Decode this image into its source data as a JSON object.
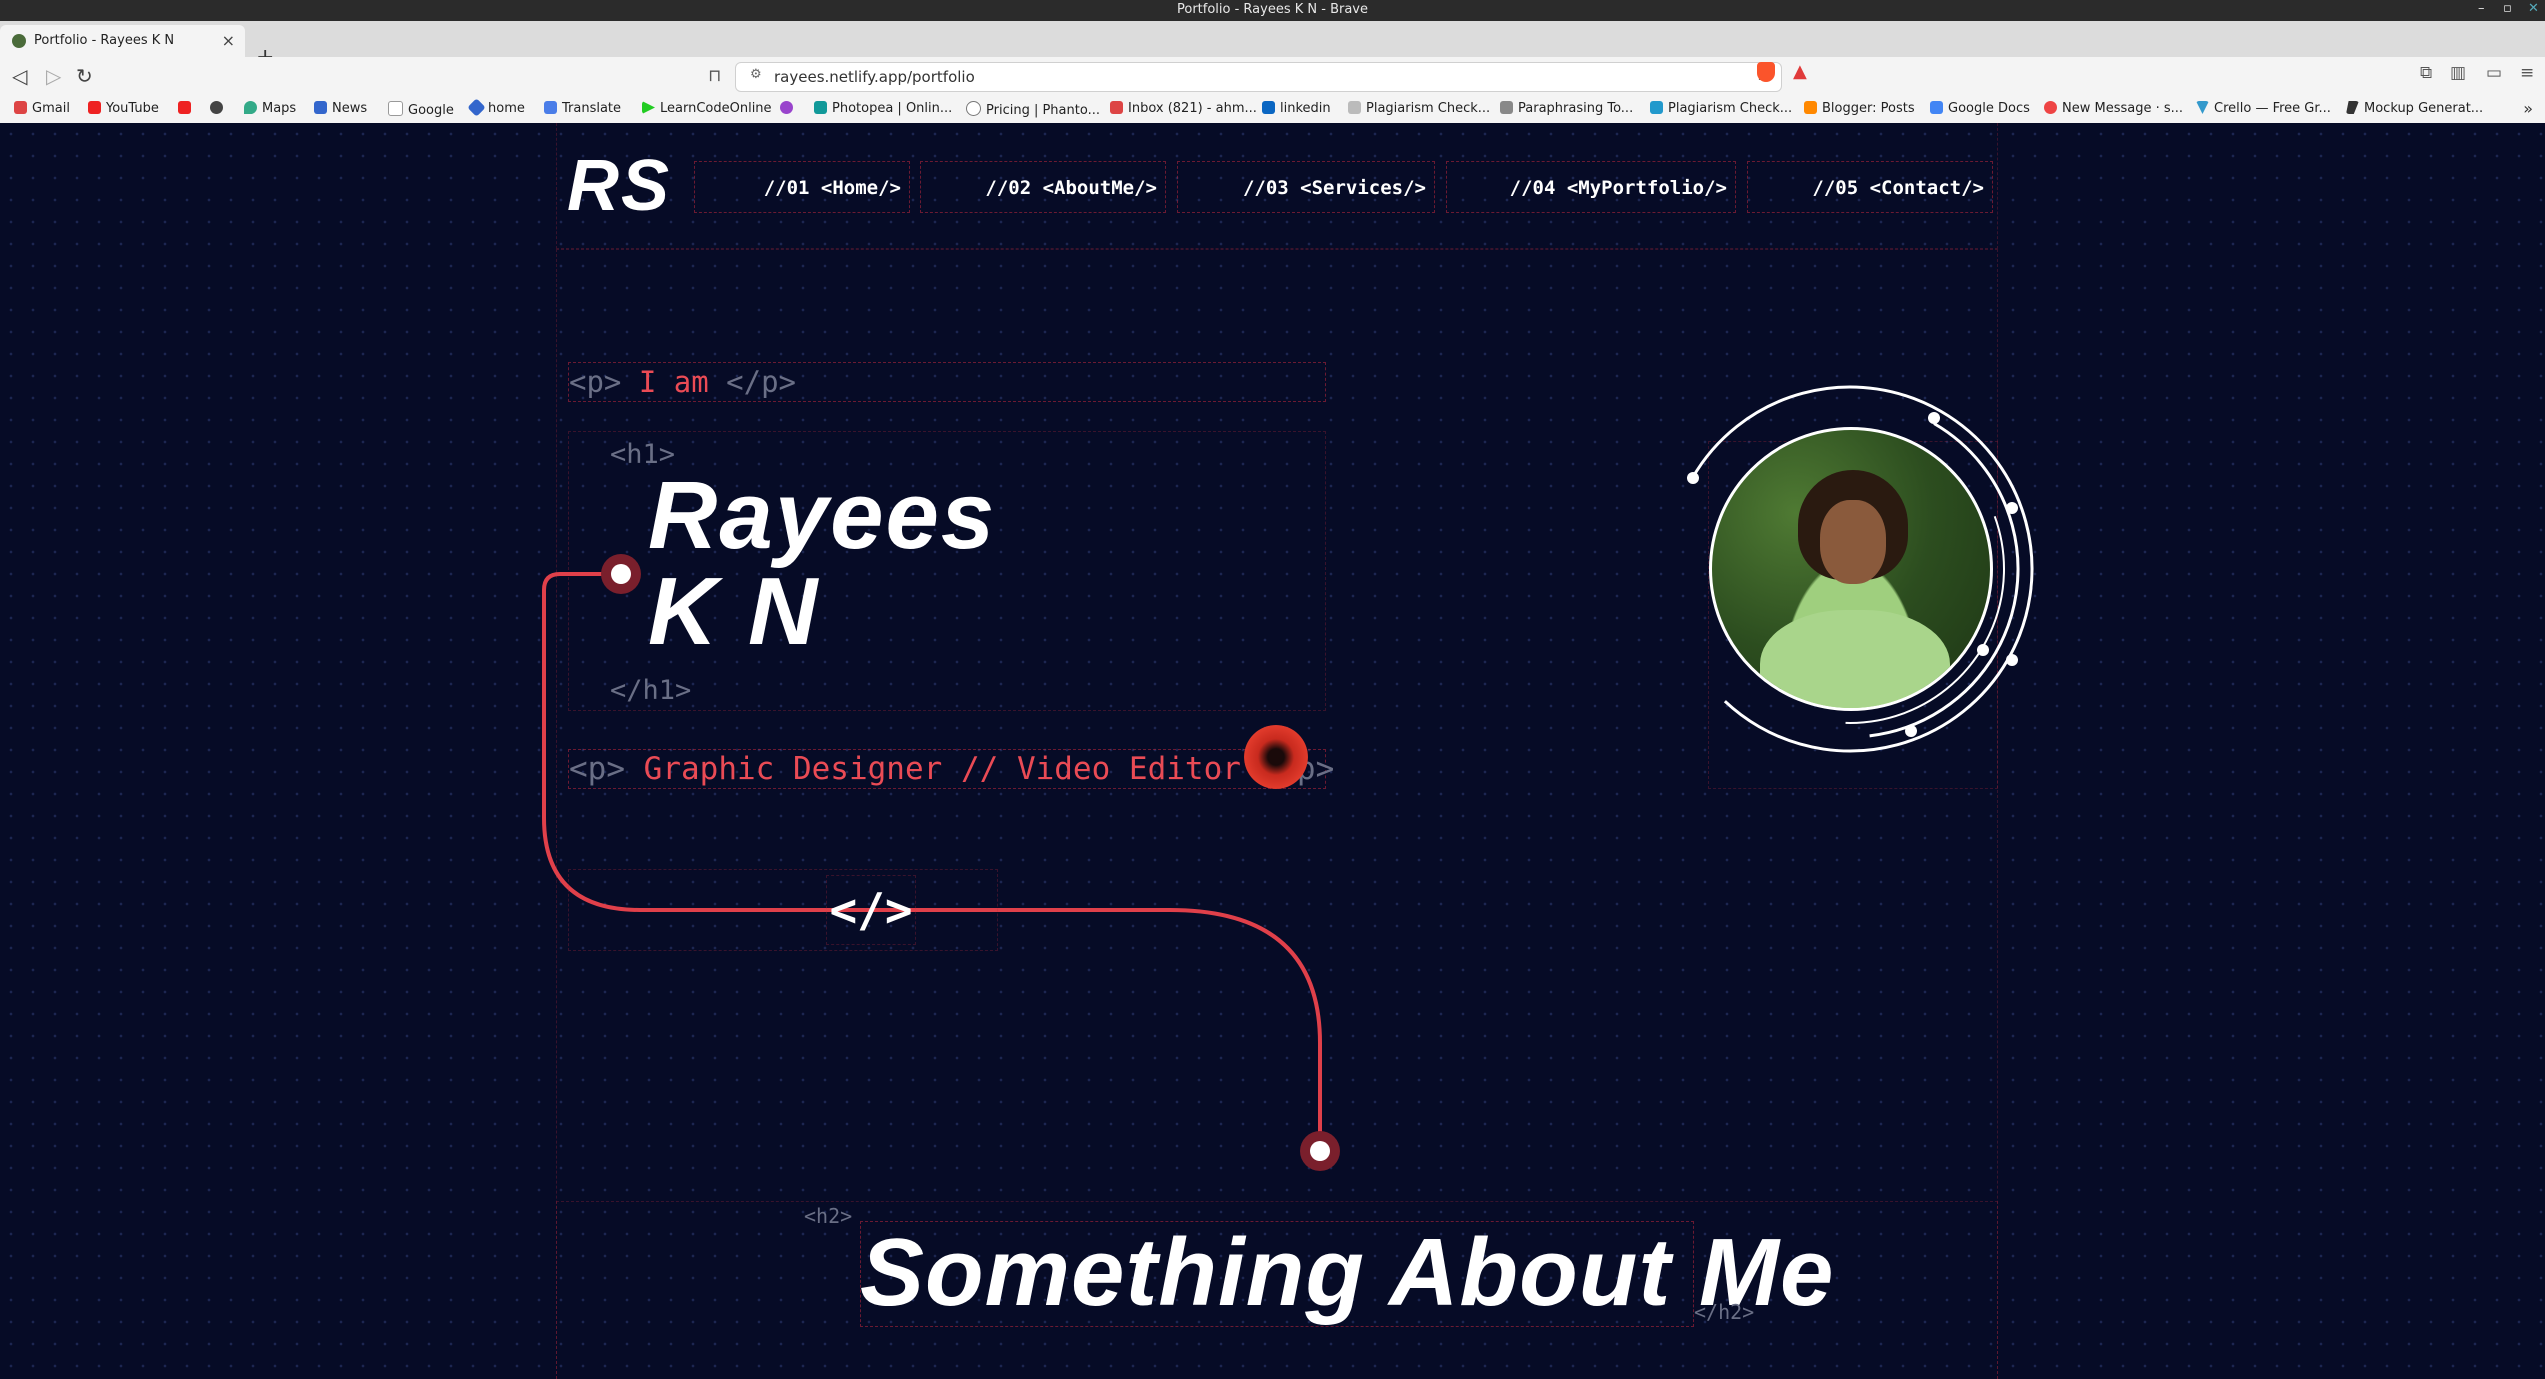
{
  "browser": {
    "window_title": "Portfolio - Rayees K N - Brave",
    "tab_title": "Portfolio - Rayees K N",
    "new_tab": "+",
    "url": "rayees.netlify.app/portfolio",
    "bookmarks": [
      "Gmail",
      "YouTube",
      "",
      "",
      "Maps",
      "News",
      "Google",
      "home",
      "Translate",
      "LearnCodeOnline",
      "",
      "Photopea | Onlin...",
      "Pricing | Phanto...",
      "Inbox (821) - ahm...",
      "linkedin",
      "Plagiarism Check...",
      "Paraphrasing To...",
      "Plagiarism Check...",
      "Blogger: Posts",
      "Google Docs",
      "New Message · s...",
      "Crello — Free Gr...",
      "Mockup Generat..."
    ]
  },
  "site": {
    "logo": "RS",
    "nav": [
      "//01 <Home/>",
      "//02 <AboutMe/>",
      "//03 <Services/>",
      "//04 <MyPortfolio/>",
      "//05 <Contact/>"
    ],
    "intro": {
      "p_open": "<p>",
      "p_text": "I am",
      "p_close": "</p>",
      "h1_open": "<h1>",
      "name_line1": "Rayees",
      "name_line2": "K N",
      "h1_close": "</h1>",
      "role_open": "<p>",
      "role_text": "Graphic Designer // Video Editor",
      "role_close": "</p>"
    },
    "code_icon": "</>",
    "about": {
      "h2_open": "<h2>",
      "heading": "Something About Me",
      "h2_close": "</h2>"
    },
    "colors": {
      "accent": "#ea4b55",
      "background": "#060b26",
      "tag_gray": "#6a6f86"
    }
  }
}
